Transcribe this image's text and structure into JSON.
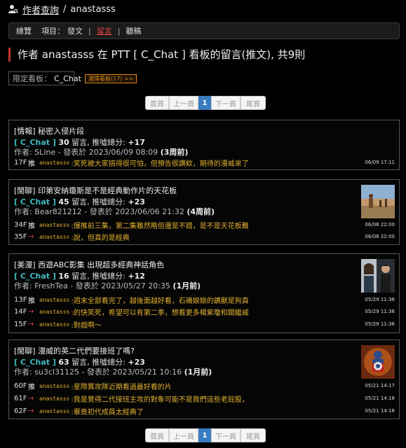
{
  "breadcrumb": {
    "root": "作者查詢",
    "sep": "/",
    "user": "anastasss"
  },
  "tabs": {
    "overview": "總覽",
    "items_label": "項目：",
    "posts": "發文",
    "sep": "|",
    "comments": "留言",
    "drafts": "聽稿"
  },
  "headline": "作者 anastasss 在 PTT [ C_Chat ] 看板的留言(推文), 共9則",
  "filter": {
    "label": "限定看板：",
    "value": "C_Chat",
    "select_button": "選擇看板(17) >>"
  },
  "pager": {
    "first": "首頁",
    "prev": "上一頁",
    "current": "1",
    "next": "下一頁",
    "last": "尾頁"
  },
  "cards": [
    {
      "title": "[情報] 秘密入侵片段",
      "board": "[ C_Chat ]",
      "comments_count": "30",
      "comments_label": " 留言, 推噓總分: ",
      "score": "+17",
      "author_prefix": "作者: ",
      "author": "SLine",
      "posted_label": " - 發表於 ",
      "posted": "2023/06/09 08:09",
      "relative": "(3周前)",
      "comments": [
        {
          "floor": "17F",
          "tag": "推",
          "user": "anastasss",
          "text": ":笑死被大家搞得很可怕，但預告很讚欸，期待的漫威來了",
          "time": "06/09 17:11"
        }
      ]
    },
    {
      "title": "[閒聊] 印第安納瓊斯是不是經典動作片的天花板",
      "board": "[ C_Chat ]",
      "comments_count": "45",
      "comments_label": " 留言, 推噓總分: ",
      "score": "+23",
      "author_prefix": "作者: ",
      "author": "Bear821212",
      "posted_label": " - 發表於 ",
      "posted": "2023/06/06 21:32",
      "relative": "(4周前)",
      "comments": [
        {
          "floor": "34F",
          "tag": "推",
          "user": "anastasss",
          "text": ":爆推前三集，第二集雖然略但還是不錯，是不是天花板難",
          "time": "06/08 22:00"
        },
        {
          "floor": "35F",
          "tag": "→",
          "user": "anastasss",
          "text": ":說，但真的是經典",
          "time": "06/08 22:00"
        }
      ]
    },
    {
      "title": "[美漫] 西遊ABC影集 出現超多經典神話角色",
      "board": "[ C_Chat ]",
      "comments_count": "16",
      "comments_label": " 留言, 推噓總分: ",
      "score": "+12",
      "author_prefix": "作者: ",
      "author": "FreshTea",
      "posted_label": " - 發表於 ",
      "posted": "2023/05/27 20:35",
      "relative": "(1月前)",
      "comments": [
        {
          "floor": "13F",
          "tag": "推",
          "user": "anastasss",
          "text": ":週末全部看完了，越後面越好看，石磯娘娘的鑣獸是狗真",
          "time": "05/29 11:36"
        },
        {
          "floor": "14F",
          "tag": "→",
          "user": "anastasss",
          "text": ":的快笑死，希望可以有第二季，想看更多楊紫瓊和關繼威",
          "time": "05/29 11:36"
        },
        {
          "floor": "15F",
          "tag": "→",
          "user": "anastasss",
          "text": ":對戲啊～",
          "time": "05/29 11:36"
        }
      ]
    },
    {
      "title": "[閒聊] 漫威的英二代們要接班了嗎?",
      "board": "[ C_Chat ]",
      "comments_count": "63",
      "comments_label": " 留言, 推噓總分: ",
      "score": "+23",
      "author_prefix": "作者: ",
      "author": "su3cl31125",
      "posted_label": " - 發表於 ",
      "posted": "2023/05/21 10:16",
      "relative": "(1月前)",
      "comments": [
        {
          "floor": "60F",
          "tag": "推",
          "user": "anastasss",
          "text": ":星際異攻隊近期看過最好看的片",
          "time": "05/21 14:17"
        },
        {
          "floor": "61F",
          "tag": "→",
          "user": "anastasss",
          "text": ":我是覺得二代接班主攻的對象可能不是我們這些老屁股，",
          "time": "05/21 14:18"
        },
        {
          "floor": "62F",
          "tag": "→",
          "user": "anastasss",
          "text": ":畢竟初代成員太經典了",
          "time": "05/21 14:18"
        }
      ]
    }
  ]
}
